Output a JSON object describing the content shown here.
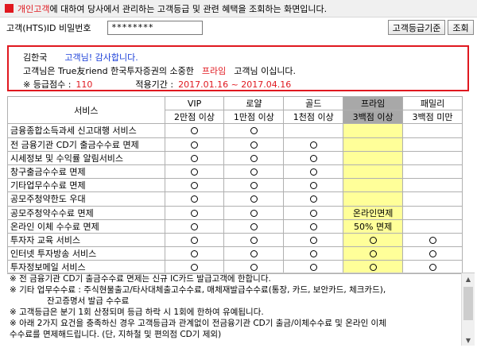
{
  "header": {
    "marker": "□",
    "highlight": "개인고객",
    "title": "에 대하여 당사에서 관리하는 고객등급 및 관련 혜택을 조회하는 화면입니다."
  },
  "auth": {
    "label": "고객(HTS)ID 비밀번호",
    "password_value": "********",
    "grade_button": "고객등급기준",
    "search_button": "조회"
  },
  "info": {
    "customer_name": "김한국",
    "thanks": "고객님! 감사합니다.",
    "line2_prefix": "고객님은 True友riend 한국투자증권의 소중한",
    "grade": "프라임",
    "line2_suffix": "고객님 이십니다.",
    "score_label": "※ 등급점수 :",
    "score_value": "110",
    "period_label": "적용기간 :",
    "period_value": "2017.01.16 ~ 2017.04.16"
  },
  "table": {
    "service_header": "서비스",
    "grades": [
      "VIP",
      "로얄",
      "골드",
      "프라임",
      "패밀리"
    ],
    "thresholds": [
      "2만점 이상",
      "1만점 이상",
      "1천점 이상",
      "3백점 이상",
      "3백점 미만"
    ],
    "highlight_column": 3,
    "rows": [
      {
        "service": "금융종합소득과세 신고대행 서비스",
        "cells": [
          "○",
          "○",
          "",
          "",
          ""
        ]
      },
      {
        "service": "전 금융기관 CD기 출금수수료 면제",
        "cells": [
          "○",
          "○",
          "○",
          "",
          ""
        ]
      },
      {
        "service": "시세정보 및 수익률 알림서비스",
        "cells": [
          "○",
          "○",
          "○",
          "",
          ""
        ]
      },
      {
        "service": "창구출금수수료 면제",
        "cells": [
          "○",
          "○",
          "○",
          "",
          ""
        ]
      },
      {
        "service": "기타업무수수료 면제",
        "cells": [
          "○",
          "○",
          "○",
          "",
          ""
        ]
      },
      {
        "service": "공모주청약한도 우대",
        "cells": [
          "○",
          "○",
          "○",
          "",
          ""
        ]
      },
      {
        "service": "공모주청약수수료 면제",
        "cells": [
          "○",
          "○",
          "○",
          "온라인면제",
          ""
        ]
      },
      {
        "service": "온라인 이체 수수료 면제",
        "cells": [
          "○",
          "○",
          "○",
          "50% 면제",
          ""
        ]
      },
      {
        "service": "투자자 교육 서비스",
        "cells": [
          "○",
          "○",
          "○",
          "○",
          "○"
        ]
      },
      {
        "service": "인터넷 투자방송 서비스",
        "cells": [
          "○",
          "○",
          "○",
          "○",
          "○"
        ]
      },
      {
        "service": "투자정보메일 서비스",
        "cells": [
          "○",
          "○",
          "○",
          "○",
          "○"
        ]
      }
    ]
  },
  "notes": [
    {
      "text": "※ 전 금융기관 CD기 출금수수료 면제는 신규 IC카드 발급고객에 한합니다.",
      "indent": false
    },
    {
      "text": "※ 기타 업무수수료 : 주식현물출고/타사대체출고수수료, 매체재발급수수료(통장, 카드, 보안카드, 체크카드),",
      "indent": false
    },
    {
      "text": "잔고증명서 발급 수수료",
      "indent": true
    },
    {
      "text": "※ 고객등급은 분기 1회 산정되며 등급 하락 시 1회에 한하여 유예됩니다.",
      "indent": false
    },
    {
      "text": "※ 아래 2가지 요건을 충족하신 경우 고객등급과 관계없이 전금융기관 CD기 출금/이체수수료 및 온라인 이체",
      "indent": false
    },
    {
      "text": "수수료를 면제해드립니다. (단, 지하철 및 편의점 CD기 제외)",
      "indent": false
    }
  ],
  "colors": {
    "accent_red": "#e0181f",
    "accent_blue": "#1b3fd8",
    "prime_header": "#a8a8a8",
    "prime_cell": "#ffff99"
  }
}
